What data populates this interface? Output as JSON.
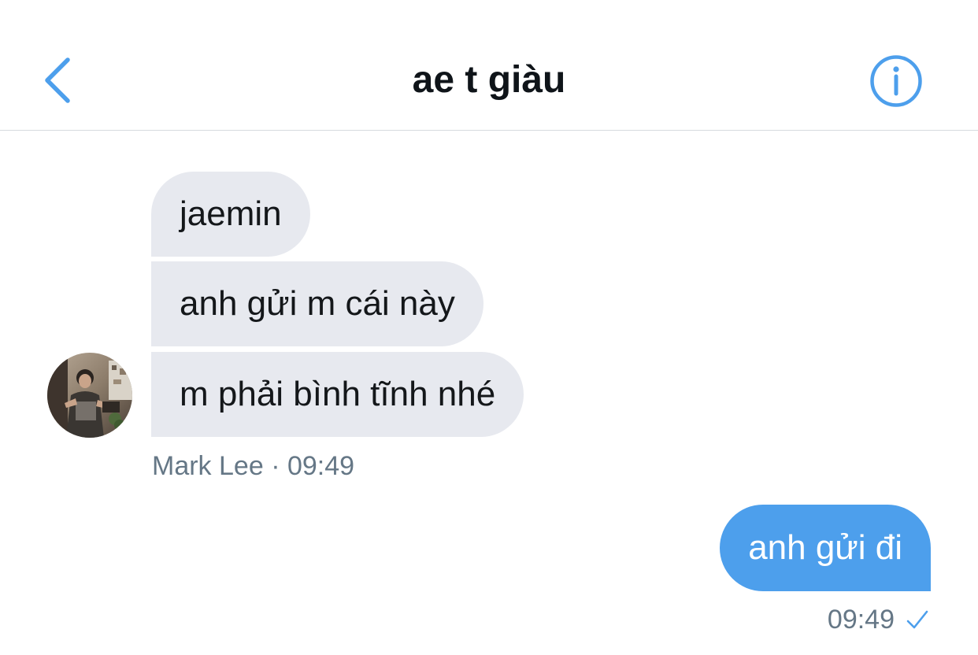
{
  "header": {
    "title": "ae t giàu",
    "back_icon": "chevron-left-icon",
    "info_icon": "info-icon",
    "accent_color": "#4d9fec"
  },
  "conversation": {
    "incoming": {
      "sender": "Mark Lee",
      "time": "09:49",
      "separator": "·",
      "messages": [
        "jaemin",
        "anh gửi m cái này",
        "m phải bình tĩnh nhé"
      ],
      "bubble_color": "#e7e9ef"
    },
    "outgoing": {
      "time": "09:49",
      "status_icon": "check-icon",
      "messages": [
        "anh gửi đi"
      ],
      "bubble_color": "#4d9fec"
    }
  }
}
